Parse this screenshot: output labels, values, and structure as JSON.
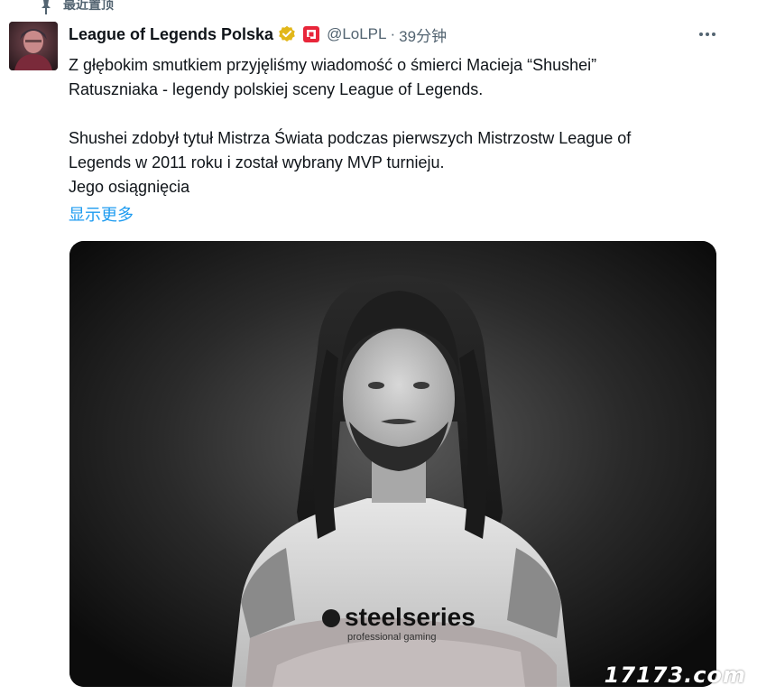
{
  "pinned": {
    "label": "最近置顶"
  },
  "tweet": {
    "display_name": "League of Legends Polska",
    "handle": "@LoLPL",
    "separator": "·",
    "time": "39分钟",
    "paragraph1_line1": "Z głębokim smutkiem przyjęliśmy wiadomość o śmierci Macieja “Shushei”",
    "paragraph1_line2": "Ratuszniaka - legendy polskiej sceny League of Legends.",
    "paragraph2_line1": "Shushei zdobył tytuł Mistrza Świata podczas pierwszych Mistrzostw League of",
    "paragraph2_line2": "Legends w 2011 roku i został wybrany MVP turnieju.",
    "paragraph2_line3": "Jego osiągnięcia",
    "show_more": "显示更多",
    "photo_shirt_text": "steelseries",
    "photo_shirt_subtext": "professional gaming"
  },
  "icons": {
    "pin": "pin-icon",
    "verified": "verified-gold-icon",
    "affiliate": "affiliate-badge-icon",
    "more": "more-horizontal-icon"
  },
  "colors": {
    "link": "#1d9bf0",
    "secondary_text": "#536471",
    "verified_gold": "#e2b719",
    "affiliate_red": "#e8263a"
  },
  "watermark": "17173.com"
}
